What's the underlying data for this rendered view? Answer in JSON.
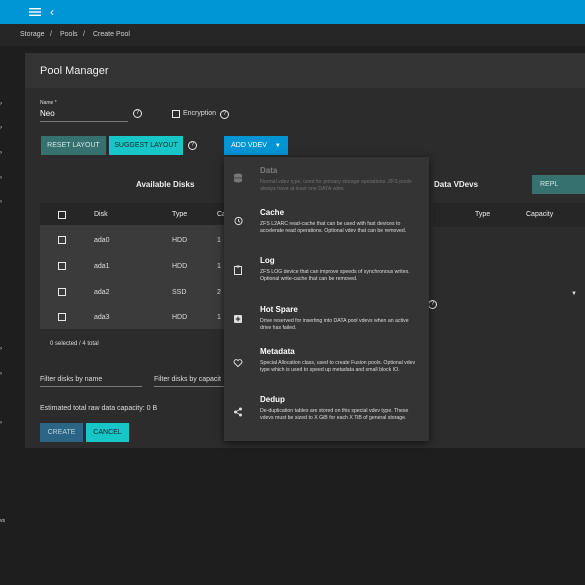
{
  "breadcrumb": {
    "storage": "Storage",
    "pools": "Pools",
    "current": "Create Pool",
    "sep": "/"
  },
  "topbar": {
    "menu_icon": "menu-icon",
    "back_icon": "chevron-left-icon"
  },
  "card": {
    "title": "Pool Manager"
  },
  "form": {
    "name_label": "Name *",
    "name_value": "Neo",
    "encryption_label": "Encryption"
  },
  "buttons": {
    "reset_layout": "RESET LAYOUT",
    "suggest_layout": "SUGGEST LAYOUT",
    "add_vdev": "ADD VDEV",
    "create": "CREATE",
    "cancel": "CANCEL",
    "repl": "REPL"
  },
  "available_disks": {
    "title": "Available Disks",
    "columns": [
      "Disk",
      "Type",
      "Ca"
    ],
    "rows": [
      {
        "disk": "ada0",
        "type": "HDD",
        "cap": "1"
      },
      {
        "disk": "ada1",
        "type": "HDD",
        "cap": "1"
      },
      {
        "disk": "ada2",
        "type": "SSD",
        "cap": "2"
      },
      {
        "disk": "ada3",
        "type": "HDD",
        "cap": "1"
      }
    ],
    "selection": "0 selected / 4 total"
  },
  "filters": {
    "by_name": "Filter disks by name",
    "by_capacity": "Filter disks by capacit"
  },
  "capacity_text": "Estimated total raw data capacity: 0 B",
  "data_vdevs": {
    "title": "Data VDevs",
    "columns": [
      "Type",
      "Capacity"
    ]
  },
  "vdev_menu": [
    {
      "title": "Data",
      "desc": "Normal vdev type, used for primary storage operations. ZFS pools always have at least one DATA vdev.",
      "icon": "database-icon",
      "disabled": true
    },
    {
      "title": "Cache",
      "desc": "ZFS L2ARC read-cache that can be used with fast devices to accelerate read operations. Optional vdev that can be removed.",
      "icon": "history-icon",
      "disabled": false
    },
    {
      "title": "Log",
      "desc": "ZFS LOG device that can improve speeds of synchronous writes. Optional write-cache that can be removed.",
      "icon": "clipboard-icon",
      "disabled": false
    },
    {
      "title": "Hot Spare",
      "desc": "Drive reserved for inserting into DATA pool vdevs when an active drive has failed.",
      "icon": "add-box-icon",
      "disabled": false
    },
    {
      "title": "Metadata",
      "desc": "Special Allocation class, used to create Fusion pools. Optional vdev type which is used to speed up metadata and small block IO.",
      "icon": "heart-icon",
      "disabled": false
    },
    {
      "title": "Dedup",
      "desc": "De-duplication tables are stored on this special vdev type. These vdevs must be sized to X GiB for each X TiB of general storage.",
      "icon": "share-icon",
      "disabled": false
    }
  ],
  "left_rail": {
    "label": "vs"
  }
}
